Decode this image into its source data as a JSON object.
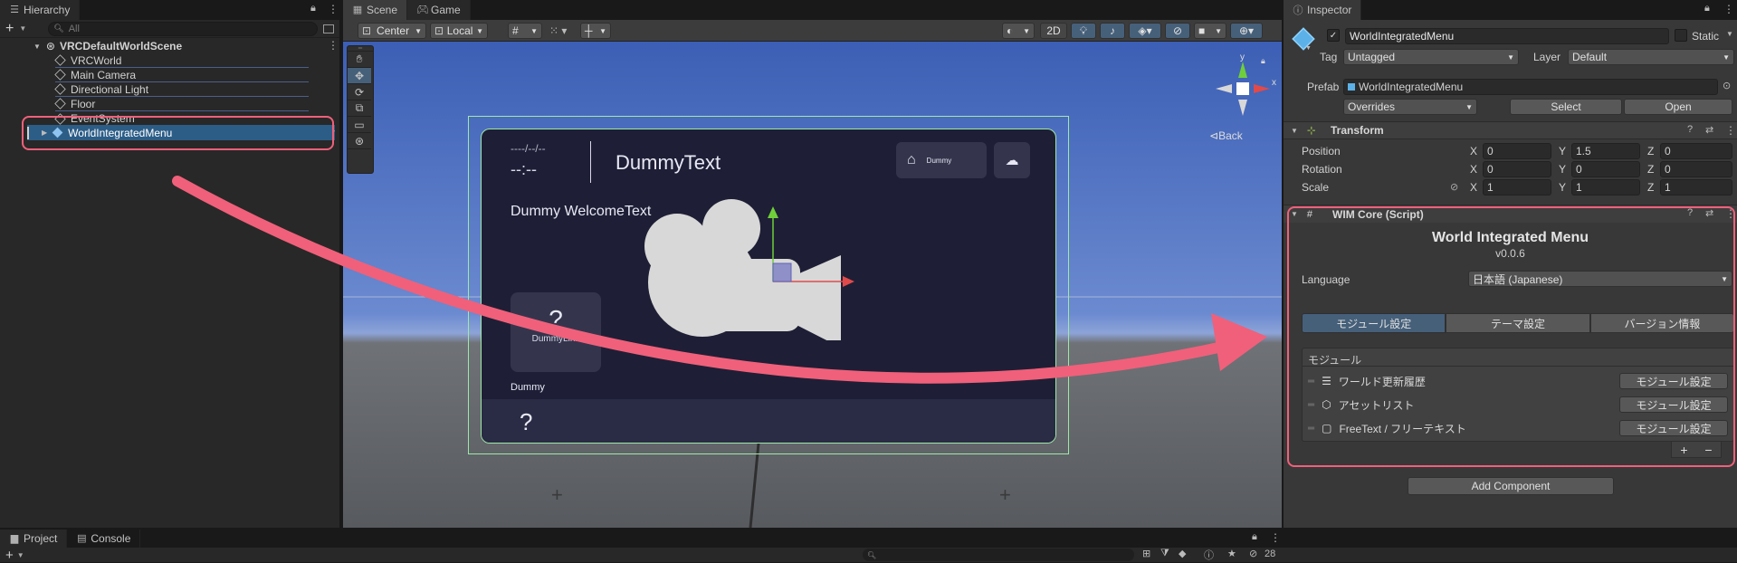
{
  "hierarchy": {
    "tab_label": "Hierarchy",
    "search_placeholder": "All",
    "scene_name": "VRCDefaultWorldScene",
    "items": [
      {
        "label": "VRCWorld"
      },
      {
        "label": "Main Camera"
      },
      {
        "label": "Directional Light"
      },
      {
        "label": "Floor"
      },
      {
        "label": "EventSystem"
      },
      {
        "label": "WorldIntegratedMenu"
      }
    ]
  },
  "scene_view": {
    "tabs": [
      {
        "label": "Scene"
      },
      {
        "label": "Game"
      }
    ],
    "pivot_label": "Center",
    "space_label": "Local",
    "mode_2d": "2D",
    "back_label": "Back",
    "gizmo_axes": {
      "x": "x",
      "y": "y"
    }
  },
  "menu_preview": {
    "date": "----/--/--",
    "time": "--:--",
    "title": "DummyText",
    "welcome": "Dummy WelcomeText",
    "home_button": "Dummy",
    "link_label": "DummyLink",
    "question": "?",
    "dummy": "Dummy"
  },
  "inspector": {
    "tab_label": "Inspector",
    "object_name": "WorldIntegratedMenu",
    "static_label": "Static",
    "tag_label": "Tag",
    "tag_value": "Untagged",
    "layer_label": "Layer",
    "layer_value": "Default",
    "prefab_label": "Prefab",
    "prefab_value": "WorldIntegratedMenu",
    "overrides_label": "Overrides",
    "select_label": "Select",
    "open_label": "Open",
    "transform": {
      "title": "Transform",
      "position": {
        "label": "Position",
        "x": "0",
        "y": "1.5",
        "z": "0"
      },
      "rotation": {
        "label": "Rotation",
        "x": "0",
        "y": "0",
        "z": "0"
      },
      "scale": {
        "label": "Scale",
        "x": "1",
        "y": "1",
        "z": "1"
      },
      "axis_x": "X",
      "axis_y": "Y",
      "axis_z": "Z"
    },
    "script": {
      "title": "WIM Core (Script)",
      "heading": "World Integrated Menu",
      "version": "v0.0.6",
      "language_label": "Language",
      "language_value": "日本語 (Japanese)",
      "tabs": [
        {
          "label": "モジュール設定"
        },
        {
          "label": "テーマ設定"
        },
        {
          "label": "バージョン情報"
        }
      ],
      "module_header": "モジュール",
      "modules": [
        {
          "label": "ワールド更新履歴",
          "button": "モジュール設定"
        },
        {
          "label": "アセットリスト",
          "button": "モジュール設定"
        },
        {
          "label": "FreeText / フリーテキスト",
          "button": "モジュール設定"
        }
      ],
      "plus": "+",
      "minus": "−"
    },
    "add_component": "Add Component"
  },
  "bottom": {
    "tabs": [
      {
        "label": "Project"
      },
      {
        "label": "Console"
      }
    ],
    "hidden_count": "28"
  },
  "colors": {
    "accent_blue": "#2c5d87",
    "highlight_red": "#f0607a",
    "sky": "#4b6dbe",
    "menu_bg": "#1e1f36"
  }
}
